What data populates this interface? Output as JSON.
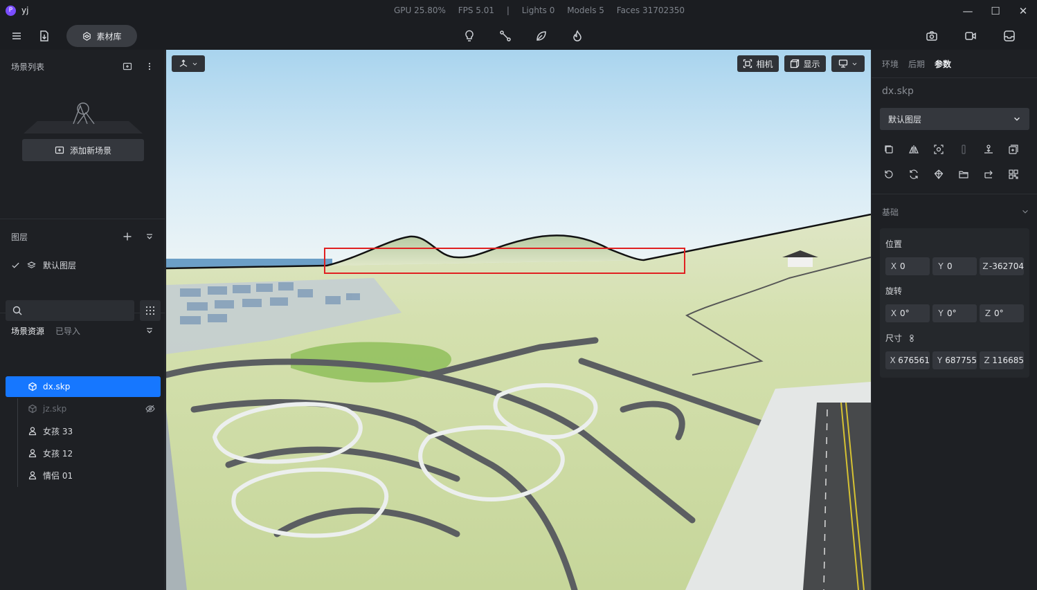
{
  "app": {
    "logo_letter": "P",
    "name": "yj"
  },
  "stats": {
    "gpu": "GPU 25.80%",
    "fps": "FPS 5.01",
    "sep": "|",
    "lights": "Lights 0",
    "models": "Models 5",
    "faces": "Faces 31702350"
  },
  "window_controls": {
    "minimize": "—",
    "maximize": "☐",
    "close": "✕"
  },
  "toolbar": {
    "library_label": "素材库"
  },
  "sidebar": {
    "scene_list_title": "场景列表",
    "add_scene_label": "添加新场景",
    "layers_title": "图层",
    "layers": [
      {
        "name": "默认图层",
        "checked": true
      }
    ],
    "tabs": {
      "scene_assets": "场景资源",
      "imported": "已导入"
    },
    "search": {
      "value": "",
      "placeholder": ""
    },
    "assets": [
      {
        "name": "dx.skp",
        "type": "model",
        "selected": true,
        "hidden": false
      },
      {
        "name": "jz.skp",
        "type": "model",
        "selected": false,
        "hidden": true
      },
      {
        "name": "女孩 33",
        "type": "person",
        "selected": false,
        "hidden": false
      },
      {
        "name": "女孩 12",
        "type": "person",
        "selected": false,
        "hidden": false
      },
      {
        "name": "情侣 01",
        "type": "person",
        "selected": false,
        "hidden": false
      }
    ]
  },
  "viewport": {
    "camera_label": "相机",
    "display_label": "显示"
  },
  "right_panel": {
    "tabs": {
      "environment": "环境",
      "post": "后期",
      "params": "参数"
    },
    "file_name": "dx.skp",
    "layer_select": "默认图层",
    "basic_title": "基础",
    "position": {
      "label": "位置",
      "x": "0",
      "y": "0",
      "z": "-362704"
    },
    "rotation": {
      "label": "旋转",
      "x": "0°",
      "y": "0°",
      "z": "0°"
    },
    "size": {
      "label": "尺寸",
      "x": "676561",
      "y": "687755",
      "z": "116685"
    },
    "axis_labels": {
      "x": "X",
      "y": "Y",
      "z": "Z"
    }
  },
  "colors": {
    "accent": "#1677ff",
    "highlight": "#e02020"
  }
}
